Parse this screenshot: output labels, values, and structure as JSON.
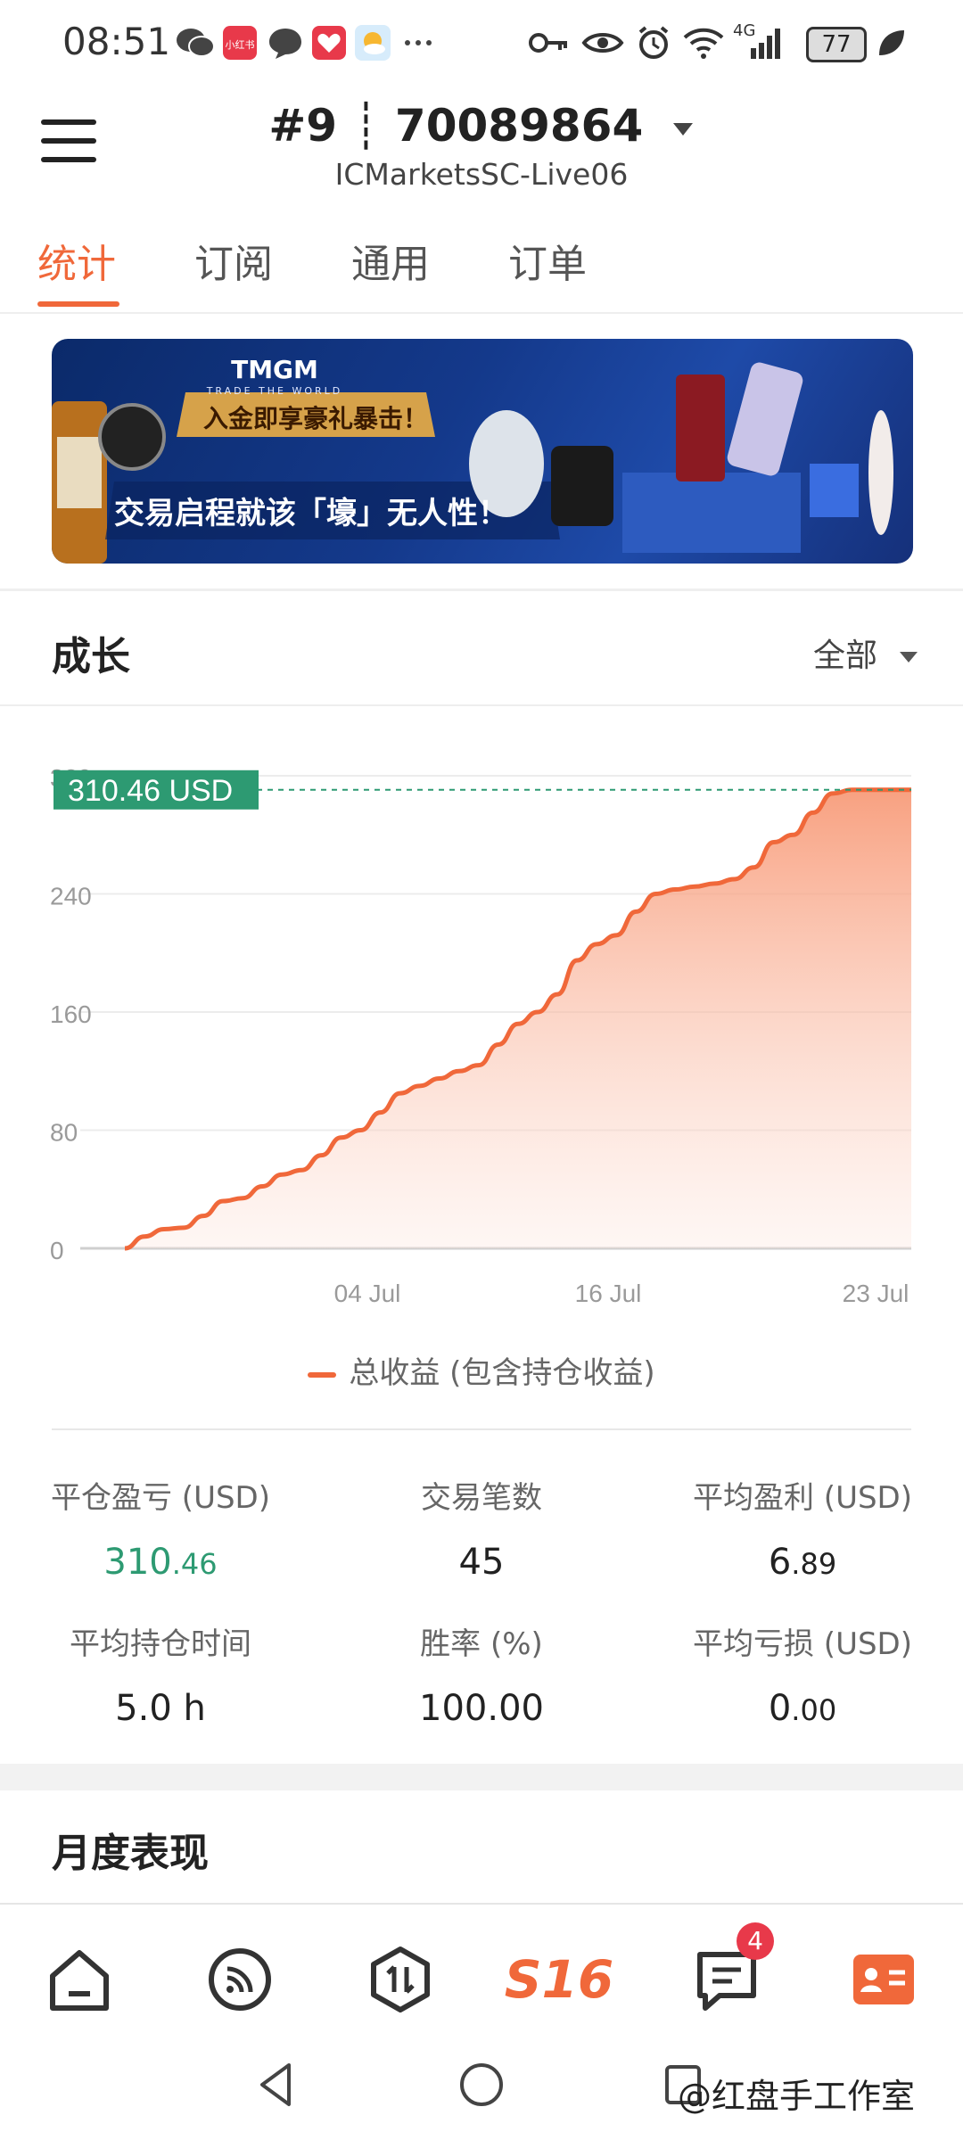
{
  "status_bar": {
    "time": "08:51",
    "network": "4G",
    "battery": "77"
  },
  "header": {
    "account_title": "#9 ┊ 70089864",
    "server": "ICMarketsSC-Live06"
  },
  "tabs": [
    "统计",
    "订阅",
    "通用",
    "订单"
  ],
  "banner": {
    "brand": "TMGM",
    "tagline": "TRADE THE WORLD",
    "headline1": "入金即享豪礼暴击！",
    "headline2": "交易启程就该「壕」无人性！"
  },
  "growth": {
    "title": "成长",
    "filter": "全部"
  },
  "chart_data": {
    "type": "area",
    "current_label": "310.46 USD",
    "y_ticks": [
      "0",
      "80",
      "160",
      "240",
      "320"
    ],
    "ylim": [
      0,
      320
    ],
    "x_ticks": [
      "04 Jul",
      "16 Jul",
      "23 Jul"
    ],
    "series": [
      {
        "name": "总收益 (包含持仓收益)",
        "values": [
          0,
          8,
          13,
          14,
          22,
          32,
          34,
          42,
          50,
          53,
          63,
          75,
          80,
          92,
          105,
          110,
          115,
          120,
          124,
          138,
          152,
          160,
          172,
          195,
          206,
          212,
          228,
          240,
          243,
          245,
          247,
          250,
          258,
          275,
          280,
          295,
          308,
          310.46,
          310.46,
          310.46,
          310.46
        ]
      }
    ]
  },
  "legend_label": "总收益 (包含持仓收益)",
  "stats": [
    {
      "label": "平仓盈亏 (USD)",
      "int": "310",
      "dec": ".46",
      "green": true
    },
    {
      "label": "交易笔数",
      "int": "45",
      "dec": "",
      "green": false
    },
    {
      "label": "平均盈利 (USD)",
      "int": "6",
      "dec": ".89",
      "green": false
    },
    {
      "label": "平均持仓时间",
      "int": "5.0 h",
      "dec": "",
      "green": false
    },
    {
      "label": "胜率 (%)",
      "int": "100.00",
      "dec": "",
      "green": false
    },
    {
      "label": "平均亏损 (USD)",
      "int": "0",
      "dec": ".00",
      "green": false
    }
  ],
  "monthly_title": "月度表现",
  "bottom_nav": {
    "brand_label": "S16",
    "messages_badge": "4"
  },
  "watermark": "@红盘手工作室",
  "colors": {
    "accent": "#f0683a",
    "green": "#2d9a72",
    "badge": "#e8394a"
  }
}
